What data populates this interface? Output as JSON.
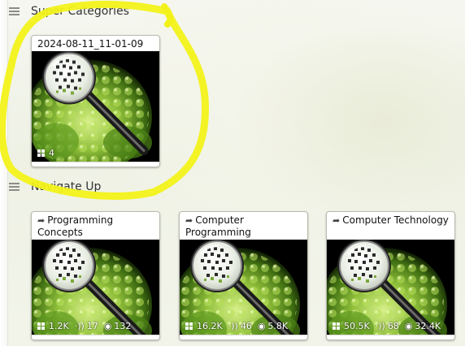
{
  "sections": {
    "super": {
      "title": "Super Categories"
    },
    "navigate": {
      "title": "Navigate Up"
    }
  },
  "super_card": {
    "title": "2024-08-11_11-01-09",
    "count": "4"
  },
  "nav_cards": [
    {
      "title": "Programming Concepts",
      "count": "1.2K",
      "listens": "17",
      "views": "132"
    },
    {
      "title": "Computer Programming",
      "count": "16.2K",
      "listens": "46",
      "views": "5.8K"
    },
    {
      "title": "Computer Technology",
      "count": "50.5K",
      "listens": "68",
      "views": "32.4K"
    }
  ],
  "icons": {
    "menu": "menu-icon",
    "share": "share-icon",
    "grid": "grid-icon",
    "sound": "sound-icon",
    "eye": "eye-icon",
    "thumbnail": "romanesco-magnifier-thumbnail"
  },
  "colors": {
    "highlight": "#f2f21a",
    "card_border": "#b9bcb0"
  }
}
